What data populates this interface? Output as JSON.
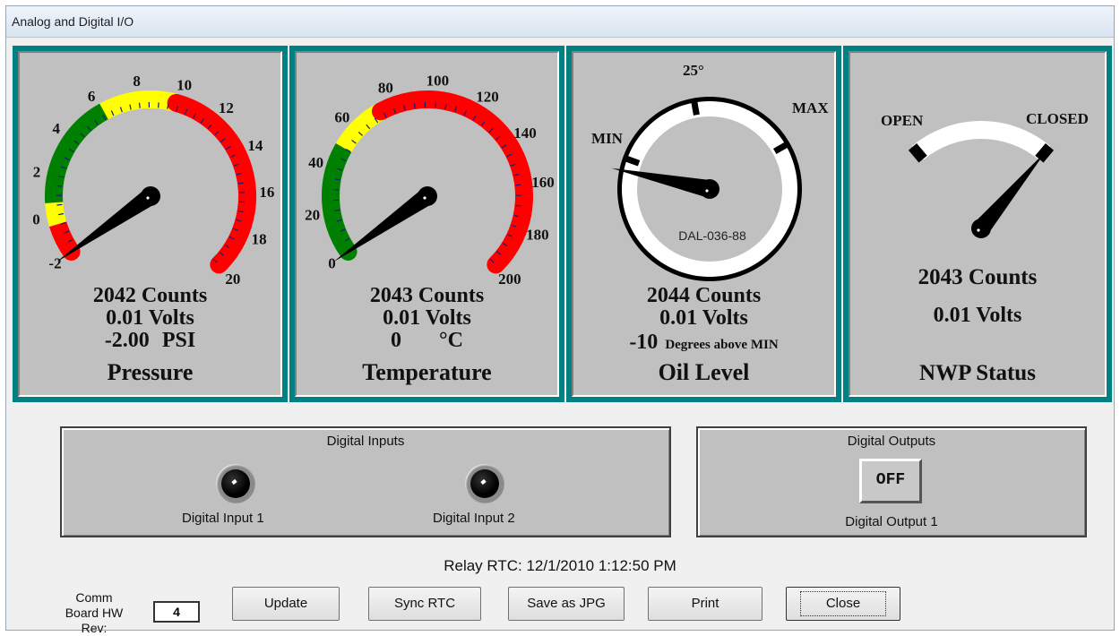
{
  "window": {
    "title": "Analog and Digital I/O"
  },
  "gauges": {
    "pressure": {
      "ticks": [
        "-2",
        "0",
        "2",
        "4",
        "6",
        "8",
        "10",
        "12",
        "14",
        "16",
        "18",
        "20"
      ],
      "value": -2,
      "counts": "2042 Counts",
      "volts": "0.01  Volts",
      "reading": "-2.00",
      "unit": "PSI",
      "name": "Pressure",
      "colors": {
        "green": "#008000",
        "yellow": "#ffff00",
        "red": "#ff0000"
      }
    },
    "temperature": {
      "ticks": [
        "0",
        "20",
        "40",
        "60",
        "80",
        "100",
        "120",
        "140",
        "160",
        "180",
        "200"
      ],
      "value": 0,
      "counts": "2043 Counts",
      "volts": "0.01  Volts",
      "reading": "0",
      "unit": "°C",
      "name": "Temperature"
    },
    "oil": {
      "min_label": "MIN",
      "max_label": "MAX",
      "mark_label": "25°",
      "dial_text": "DAL-036-88",
      "counts": "2044 Counts",
      "volts": "0.01  Volts",
      "reading": "-10",
      "unit": "Degrees above MIN",
      "name": "Oil Level"
    },
    "nwp": {
      "open_label": "OPEN",
      "closed_label": "CLOSED",
      "state": "CLOSED",
      "counts": "2043 Counts",
      "volts": "0.01  Volts",
      "name": "NWP Status"
    }
  },
  "digital_inputs": {
    "title": "Digital Inputs",
    "items": [
      {
        "label": "Digital Input 1"
      },
      {
        "label": "Digital Input 2"
      }
    ]
  },
  "digital_outputs": {
    "title": "Digital Outputs",
    "button": "OFF",
    "label": "Digital Output 1"
  },
  "rtc": "Relay RTC: 12/1/2010 1:12:50 PM",
  "footer": {
    "hwrev_label": "Comm Board HW Rev:",
    "hwrev_value": "4",
    "buttons": {
      "update": "Update",
      "sync": "Sync RTC",
      "save": "Save as JPG",
      "print": "Print",
      "close": "Close"
    }
  }
}
